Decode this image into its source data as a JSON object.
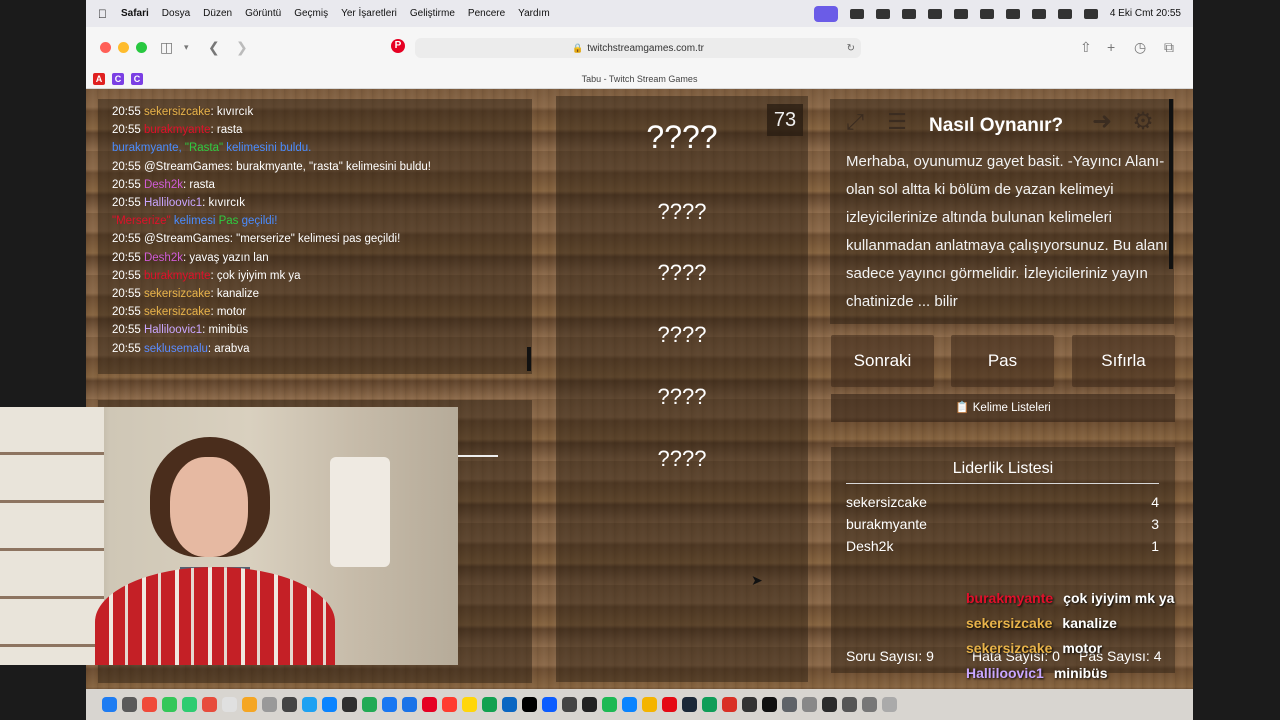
{
  "menubar": {
    "app": "Safari",
    "items": [
      "Dosya",
      "Düzen",
      "Görüntü",
      "Geçmiş",
      "Yer İşaretleri",
      "Geliştirme",
      "Pencere",
      "Yardım"
    ],
    "datetime": "4 Eki Cmt  20:55"
  },
  "browser": {
    "url": "twitchstreamgames.com.tr",
    "tab_title": "Tabu - Twitch Stream Games"
  },
  "chat": [
    {
      "time": "20:55",
      "user": "sekersizcake",
      "user_color": "#e8b34a",
      "message": ": kıvırcık"
    },
    {
      "time": "20:55",
      "user": "burakmyante",
      "user_color": "#e0102a",
      "message": ": rasta"
    },
    {
      "system": "burakmyante, \"Rasta\" kelimesini buldu.",
      "parts": [
        {
          "text": "burakmyante, ",
          "color": "#4a8cff"
        },
        {
          "text": "\"Rasta\"",
          "color": "#2ecc40"
        },
        {
          "text": " kelimesini buldu.",
          "color": "#4a8cff"
        }
      ]
    },
    {
      "time": "20:55",
      "user": "@StreamGames",
      "user_color": "#ffffff",
      "message": ": burakmyante, \"rasta\" kelimesini buldu!"
    },
    {
      "time": "20:55",
      "user": "Desh2k",
      "user_color": "#d05cd6",
      "message": ": rasta"
    },
    {
      "time": "20:55",
      "user": "Halliloovic1",
      "user_color": "#c9a6ff",
      "message": ": kıvırcık"
    },
    {
      "system": "\"Merserize\" kelimesi Pas geçildi!",
      "parts": [
        {
          "text": "\"Merserize\"",
          "color": "#e0102a"
        },
        {
          "text": " kelimesi ",
          "color": "#4a8cff"
        },
        {
          "text": "Pas",
          "color": "#2ecc40"
        },
        {
          "text": " geçildi!",
          "color": "#4a8cff"
        }
      ]
    },
    {
      "time": "20:55",
      "user": "@StreamGames",
      "user_color": "#ffffff",
      "message": ": \"merserize\" kelimesi pas geçildi!"
    },
    {
      "time": "20:55",
      "user": "Desh2k",
      "user_color": "#d05cd6",
      "message": ": yavaş yazın lan"
    },
    {
      "time": "20:55",
      "user": "burakmyante",
      "user_color": "#e0102a",
      "message": ": çok iyiyim mk ya"
    },
    {
      "time": "20:55",
      "user": "sekersizcake",
      "user_color": "#e8b34a",
      "message": ": kanalize"
    },
    {
      "time": "20:55",
      "user": "sekersizcake",
      "user_color": "#e8b34a",
      "message": ": motor"
    },
    {
      "time": "20:55",
      "user": "Halliloovic1",
      "user_color": "#c9a6ff",
      "message": ": minibüs"
    },
    {
      "time": "20:55",
      "user": "seklusemalu",
      "user_color": "#5b8cff",
      "message": ": arabva"
    }
  ],
  "game": {
    "timer": "73",
    "target_word": "????",
    "taboo_words": [
      "????",
      "????",
      "????",
      "????",
      "????"
    ],
    "howto_title": "Nasıl Oynanır?",
    "howto_text": "Merhaba, oyunumuz gayet basit. -Yayıncı Alanı- olan sol altta ki bölüm de yazan kelimeyi izleyicilerinize altında bulunan kelimeleri kullanmadan anlatmaya çalışıyorsunuz. Bu alanı sadece yayıncı görmelidir. İzleyicileriniz yayın chatinizde ... bilir",
    "buttons": {
      "next": "Sonraki",
      "pass": "Pas",
      "reset": "Sıfırla"
    },
    "word_lists": "Kelime Listeleri",
    "leaderboard_title": "Liderlik Listesi",
    "leaderboard": [
      {
        "name": "sekersizcake",
        "score": "4"
      },
      {
        "name": "burakmyante",
        "score": "3"
      },
      {
        "name": "Desh2k",
        "score": "1"
      }
    ],
    "stats": {
      "questions": "Soru Sayısı: 9",
      "errors": "Hata Sayısı: 0",
      "passes": "Pas Sayısı: 4"
    }
  },
  "overlay_chat": [
    {
      "user": "burakmyante",
      "color": "#e0102a",
      "message": "çok iyiyim mk ya"
    },
    {
      "user": "sekersizcake",
      "color": "#e8b34a",
      "message": "kanalize"
    },
    {
      "user": "sekersizcake",
      "color": "#e8b34a",
      "message": "motor"
    },
    {
      "user": "Halliloovic1",
      "color": "#c9a6ff",
      "message": "minibüs"
    },
    {
      "user": "seklusemalu",
      "color": "#5b8cff",
      "message": "arabva"
    }
  ]
}
